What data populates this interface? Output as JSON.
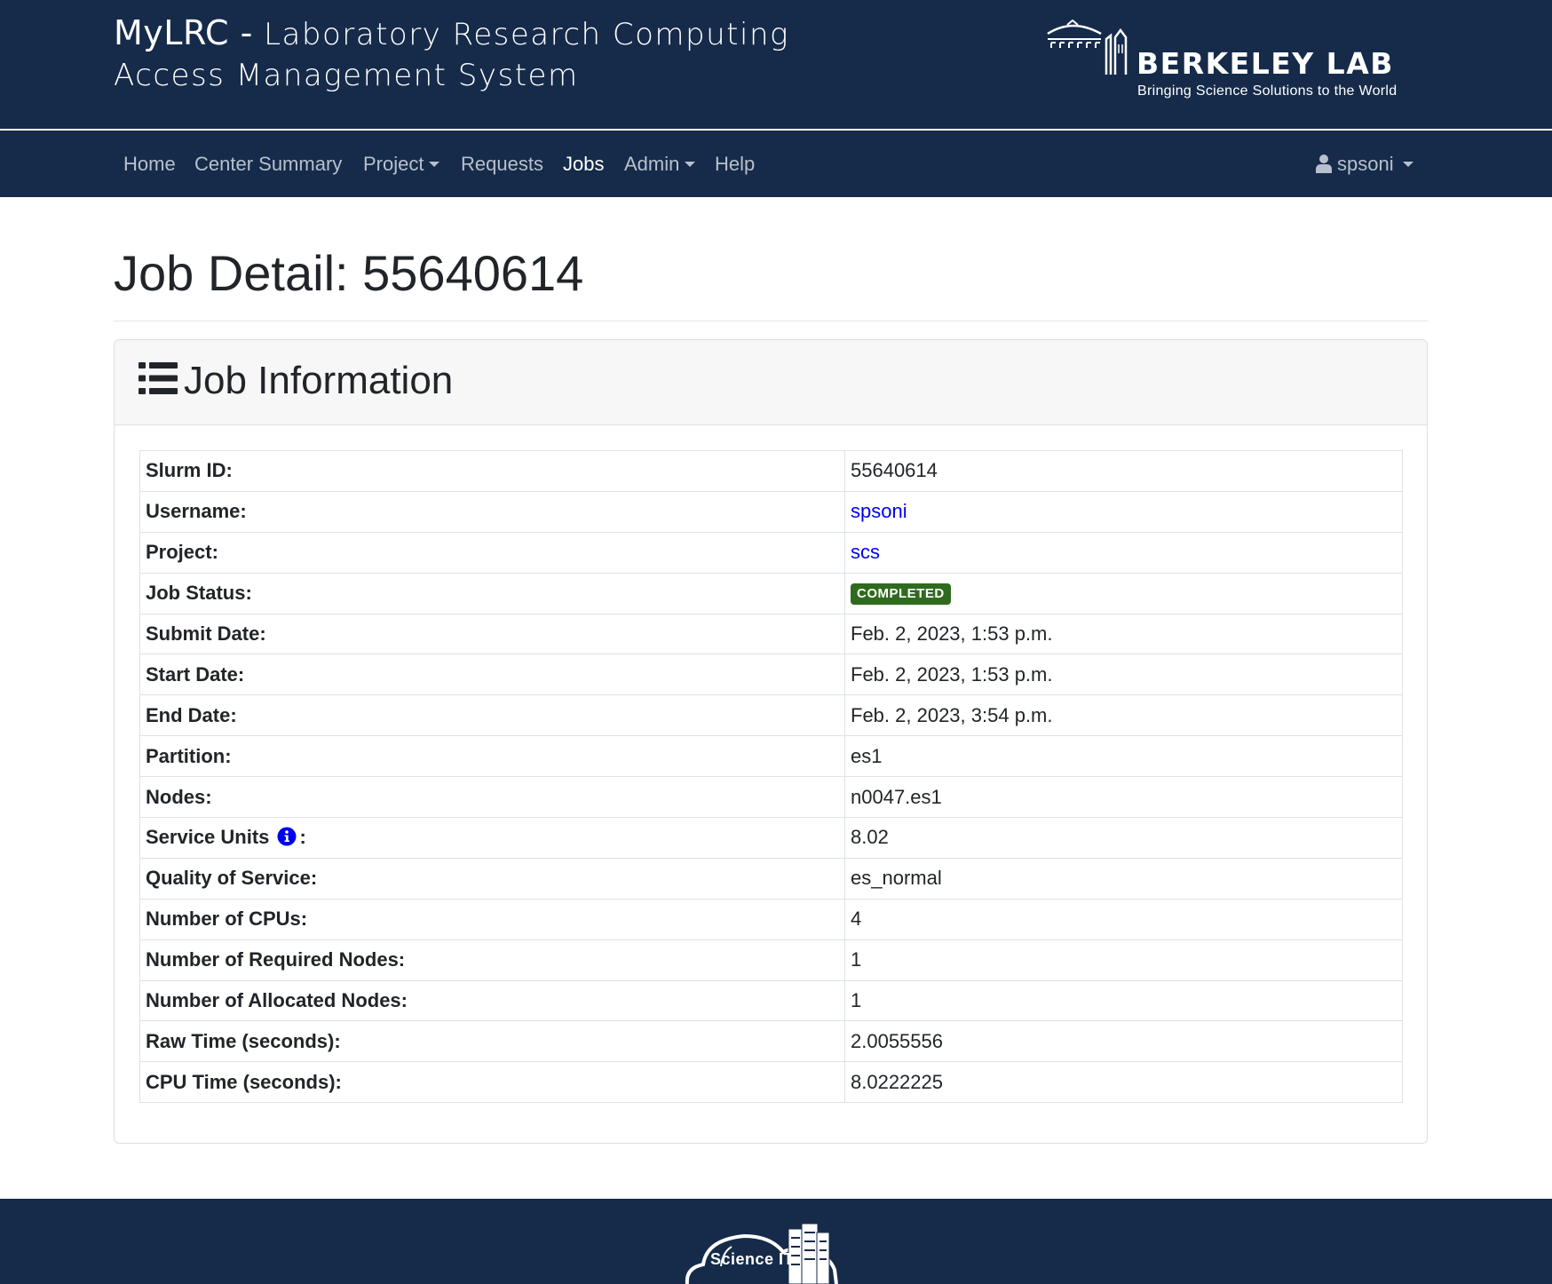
{
  "header": {
    "brand_strong": "MyLRC -",
    "brand_line1": "Laboratory Research Computing",
    "brand_line2": "Access Management System",
    "lab_name": "BERKELEY LAB",
    "lab_tagline": "Bringing Science Solutions to the World"
  },
  "nav": {
    "home": "Home",
    "center_summary": "Center Summary",
    "project": "Project",
    "requests": "Requests",
    "jobs": "Jobs",
    "admin": "Admin",
    "help": "Help",
    "user": "spsoni",
    "active": "jobs"
  },
  "page": {
    "title": "Job Detail: 55640614"
  },
  "card": {
    "title": "Job Information",
    "icon": "list-icon"
  },
  "job": {
    "rows": [
      {
        "label": "Slurm ID:",
        "value": "55640614"
      },
      {
        "label": "Username:",
        "value": "spsoni"
      },
      {
        "label": "Project:",
        "value": "scs"
      },
      {
        "label": "Job Status:",
        "value": "COMPLETED"
      },
      {
        "label": "Submit Date:",
        "value": "Feb. 2, 2023, 1:53 p.m."
      },
      {
        "label": "Start Date:",
        "value": "Feb. 2, 2023, 1:53 p.m."
      },
      {
        "label": "End Date:",
        "value": "Feb. 2, 2023, 3:54 p.m."
      },
      {
        "label": "Partition:",
        "value": "es1"
      },
      {
        "label": "Nodes:",
        "value": "n0047.es1"
      },
      {
        "label": "Service Units",
        "suffix": ":",
        "value": "8.02"
      },
      {
        "label": "Quality of Service:",
        "value": "es_normal"
      },
      {
        "label": "Number of CPUs:",
        "value": "4"
      },
      {
        "label": "Number of Required Nodes:",
        "value": "1"
      },
      {
        "label": "Number of Allocated Nodes:",
        "value": "1"
      },
      {
        "label": "Raw Time (seconds):",
        "value": "2.0055556"
      },
      {
        "label": "CPU Time (seconds):",
        "value": "8.0222225"
      }
    ]
  },
  "footer": {
    "logo_text": "Science IT"
  },
  "colors": {
    "navy": "#162b4a",
    "link": "#0000ee",
    "status_completed": "#2f6b1e",
    "info_icon": "#0000ee"
  }
}
